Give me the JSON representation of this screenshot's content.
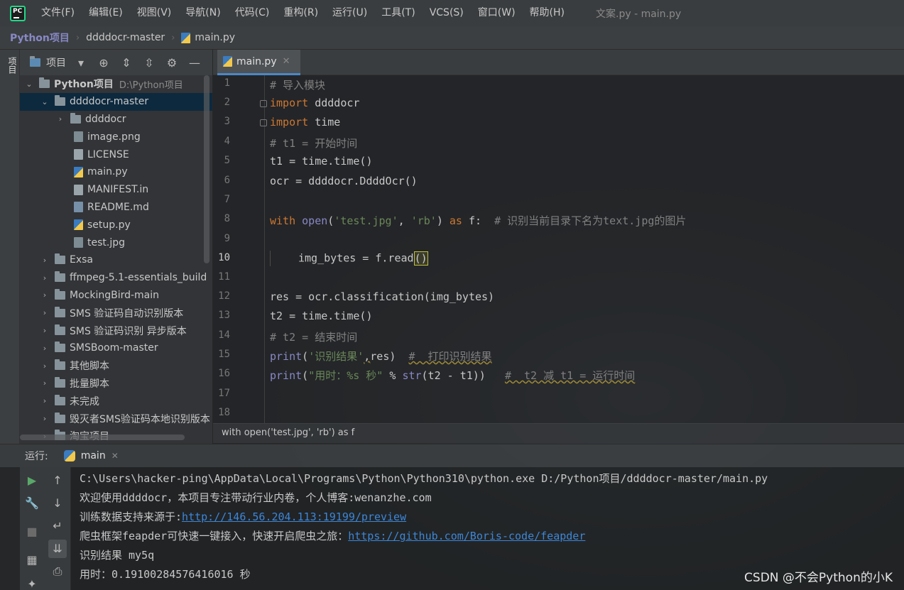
{
  "menubar": {
    "logo": "PC",
    "items": [
      "文件(F)",
      "编辑(E)",
      "视图(V)",
      "导航(N)",
      "代码(C)",
      "重构(R)",
      "运行(U)",
      "工具(T)",
      "VCS(S)",
      "窗口(W)",
      "帮助(H)"
    ],
    "window_title": "文案.py - main.py"
  },
  "navbar": {
    "crumbs": [
      "Python项目",
      "ddddocr-master",
      "main.py"
    ]
  },
  "left_strip": {
    "tab_label": "项目"
  },
  "project_toolbar": {
    "label": "项目"
  },
  "tree": {
    "root_name": "Python项目",
    "root_path": "D:\\Python项目",
    "items": [
      {
        "label": "ddddocr-master",
        "kind": "folder",
        "depth": 1,
        "expanded": true,
        "selected": true
      },
      {
        "label": "ddddocr",
        "kind": "folder",
        "depth": 2,
        "expanded": false
      },
      {
        "label": "image.png",
        "kind": "img",
        "depth": 2
      },
      {
        "label": "LICENSE",
        "kind": "txt",
        "depth": 2
      },
      {
        "label": "main.py",
        "kind": "py",
        "depth": 2
      },
      {
        "label": "MANIFEST.in",
        "kind": "txt",
        "depth": 2
      },
      {
        "label": "README.md",
        "kind": "md",
        "depth": 2
      },
      {
        "label": "setup.py",
        "kind": "py",
        "depth": 2
      },
      {
        "label": "test.jpg",
        "kind": "img",
        "depth": 2
      },
      {
        "label": "Exsa",
        "kind": "folder",
        "depth": 1
      },
      {
        "label": "ffmpeg-5.1-essentials_build",
        "kind": "folder",
        "depth": 1
      },
      {
        "label": "MockingBird-main",
        "kind": "folder",
        "depth": 1
      },
      {
        "label": "SMS 验证码自动识别版本",
        "kind": "folder",
        "depth": 1
      },
      {
        "label": "SMS 验证码识别 异步版本",
        "kind": "folder",
        "depth": 1
      },
      {
        "label": "SMSBoom-master",
        "kind": "folder",
        "depth": 1
      },
      {
        "label": "其他脚本",
        "kind": "folder",
        "depth": 1
      },
      {
        "label": "批量脚本",
        "kind": "folder",
        "depth": 1
      },
      {
        "label": "未完成",
        "kind": "folder",
        "depth": 1
      },
      {
        "label": "毁灭者SMS验证码本地识别版本",
        "kind": "folder",
        "depth": 1
      },
      {
        "label": "淘宝项目",
        "kind": "folder",
        "depth": 1
      }
    ]
  },
  "editor": {
    "tab": "main.py",
    "current_line": 10,
    "line_numbers": [
      "1",
      "2",
      "3",
      "4",
      "5",
      "6",
      "7",
      "8",
      "9",
      "10",
      "11",
      "12",
      "13",
      "14",
      "15",
      "16",
      "17",
      "18"
    ],
    "lines": {
      "l1": "# 导入模块",
      "l2_kw": "import",
      "l2_rest": " ddddocr",
      "l3_kw": "import",
      "l3_rest": " time",
      "l4": "# t1 = 开始时间",
      "l5": "t1 = time.time()",
      "l6": "ocr = ddddocr.DdddOcr()",
      "l8_kw": "with",
      "l8_open": "open",
      "l8_p1": "(",
      "l8_s1": "'test.jpg'",
      "l8_p2": ", ",
      "l8_s2": "'rb'",
      "l8_p3": ") ",
      "l8_as": "as",
      "l8_p4": " f:  ",
      "l8_c": "# 识别当前目录下名为text.jpg的图片",
      "l10_a": "img_bytes = f.read",
      "l10_b": "()",
      "l12": "res = ocr.classification(img_bytes)",
      "l13": "t2 = time.time()",
      "l14": "# t2 = 结束时间",
      "l15_fn": "print",
      "l15_p": "(",
      "l15_s": "'识别结果'",
      "l15_comma": ",",
      "l15_rest": "res)  ",
      "l15_c": "#  打印识别结果",
      "l16_fn": "print",
      "l16_p": "(",
      "l16_s": "\"用时：%s 秒\"",
      "l16_mid": " % ",
      "l16_str": "str",
      "l16_rest": "(t2 - t1))   ",
      "l16_c": "#  t2 减 t1 = 运行时间"
    }
  },
  "editor_breadcrumb": "with open('test.jpg', 'rb') as f",
  "run": {
    "label": "运行:",
    "tab": "main",
    "console": {
      "line1": "C:\\Users\\hacker-ping\\AppData\\Local\\Programs\\Python\\Python310\\python.exe D:/Python项目/ddddocr-master/main.py",
      "line2": "欢迎使用ddddocr，本项目专注带动行业内卷，个人博客:wenanzhe.com",
      "line3_text": "训练数据支持来源于:",
      "line3_link": "http://146.56.204.113:19199/preview",
      "line4_text": "爬虫框架feapder可快速一键接入，快速开启爬虫之旅：",
      "line4_link": "https://github.com/Boris-code/feapder",
      "line5": "识别结果 my5q",
      "line6": "用时：0.19100284576416016 秒"
    }
  },
  "watermark": "CSDN @不会Python的小K"
}
